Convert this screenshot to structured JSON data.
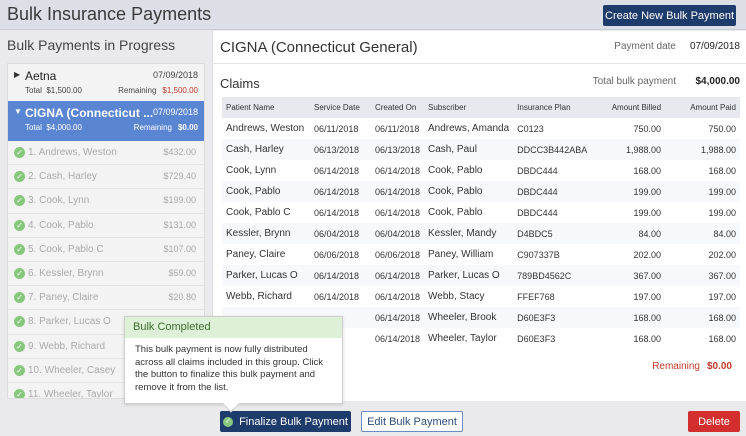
{
  "header": {
    "title": "Bulk Insurance Payments",
    "new_button": "Create New Bulk Payment"
  },
  "left": {
    "title": "Bulk Payments in Progress",
    "groups": [
      {
        "name": "Aetna",
        "date": "07/09/2018",
        "total_label": "Total",
        "total": "$1,500.00",
        "remaining_label": "Remaining",
        "remaining": "$1,500.00"
      },
      {
        "name": "CIGNA (Connecticut ...",
        "date": "07/09/2018",
        "total_label": "Total",
        "total": "$4,000.00",
        "remaining_label": "Remaining",
        "remaining": "$0.00"
      }
    ],
    "claims": [
      {
        "label": "1. Andrews, Weston",
        "amount": "$432.00"
      },
      {
        "label": "2. Cash, Harley",
        "amount": "$729.40"
      },
      {
        "label": "3. Cook, Lynn",
        "amount": "$199.00"
      },
      {
        "label": "4. Cook, Pablo",
        "amount": "$131.00"
      },
      {
        "label": "5. Cook, Pablo C",
        "amount": "$107.00"
      },
      {
        "label": "6. Kessler, Brynn",
        "amount": "$59.00"
      },
      {
        "label": "7. Paney, Claire",
        "amount": "$20.80"
      },
      {
        "label": "8. Parker, Lucas O",
        "amount": ""
      },
      {
        "label": "9. Webb, Richard",
        "amount": ""
      },
      {
        "label": "10. Wheeler, Casey",
        "amount": ""
      },
      {
        "label": "11. Wheeler, Taylor",
        "amount": ""
      }
    ]
  },
  "main": {
    "insurer": "CIGNA (Connecticut General)",
    "payment_date_label": "Payment date",
    "payment_date": "07/09/2018",
    "claims_label": "Claims",
    "total_label": "Total bulk payment",
    "total": "$4,000.00",
    "columns": [
      "Patient Name",
      "Service Date",
      "Created On",
      "Subscriber",
      "Insurance Plan",
      "Amount Billed",
      "Amount Paid"
    ],
    "rows": [
      [
        "Andrews, Weston",
        "06/11/2018",
        "06/11/2018",
        "Andrews, Amanda",
        "C0123",
        "750.00",
        "750.00"
      ],
      [
        "Cash, Harley",
        "06/13/2018",
        "06/13/2018",
        "Cash, Paul",
        "DDCC3B442ABA",
        "1,988.00",
        "1,988.00"
      ],
      [
        "Cook, Lynn",
        "06/14/2018",
        "06/14/2018",
        "Cook, Pablo",
        "DBDC444",
        "168.00",
        "168.00"
      ],
      [
        "Cook, Pablo",
        "06/14/2018",
        "06/14/2018",
        "Cook, Pablo",
        "DBDC444",
        "199.00",
        "199.00"
      ],
      [
        "Cook, Pablo C",
        "06/14/2018",
        "06/14/2018",
        "Cook, Pablo",
        "DBDC444",
        "199.00",
        "199.00"
      ],
      [
        "Kessler, Brynn",
        "06/04/2018",
        "06/04/2018",
        "Kessler, Mandy",
        "D4BDC5",
        "84.00",
        "84.00"
      ],
      [
        "Paney, Claire",
        "06/06/2018",
        "06/06/2018",
        "Paney, William",
        "C907337B",
        "202.00",
        "202.00"
      ],
      [
        "Parker, Lucas O",
        "06/14/2018",
        "06/14/2018",
        "Parker, Lucas O",
        "789BD4562C",
        "367.00",
        "367.00"
      ],
      [
        "Webb, Richard",
        "06/14/2018",
        "06/14/2018",
        "Webb, Stacy",
        "FFEF768",
        "197.00",
        "197.00"
      ],
      [
        "",
        "",
        "06/14/2018",
        "Wheeler, Brook",
        "D60E3F3",
        "168.00",
        "168.00"
      ],
      [
        "",
        "",
        "06/14/2018",
        "Wheeler, Taylor",
        "D60E3F3",
        "168.00",
        "168.00"
      ]
    ],
    "remaining_label": "Remaining",
    "remaining": "$0.00"
  },
  "popover": {
    "title": "Bulk Completed",
    "body": "This bulk payment is now fully distributed across all claims included in this group. Click the button to finalize this bulk payment and remove it from the list."
  },
  "footer": {
    "finalize": "Finalize Bulk Payment",
    "edit": "Edit Bulk Payment",
    "delete": "Delete"
  },
  "colors": {
    "navy": "#1d3b6b",
    "active_blue": "#5a85d3",
    "danger": "#d32f2f",
    "success": "#88c77e"
  }
}
